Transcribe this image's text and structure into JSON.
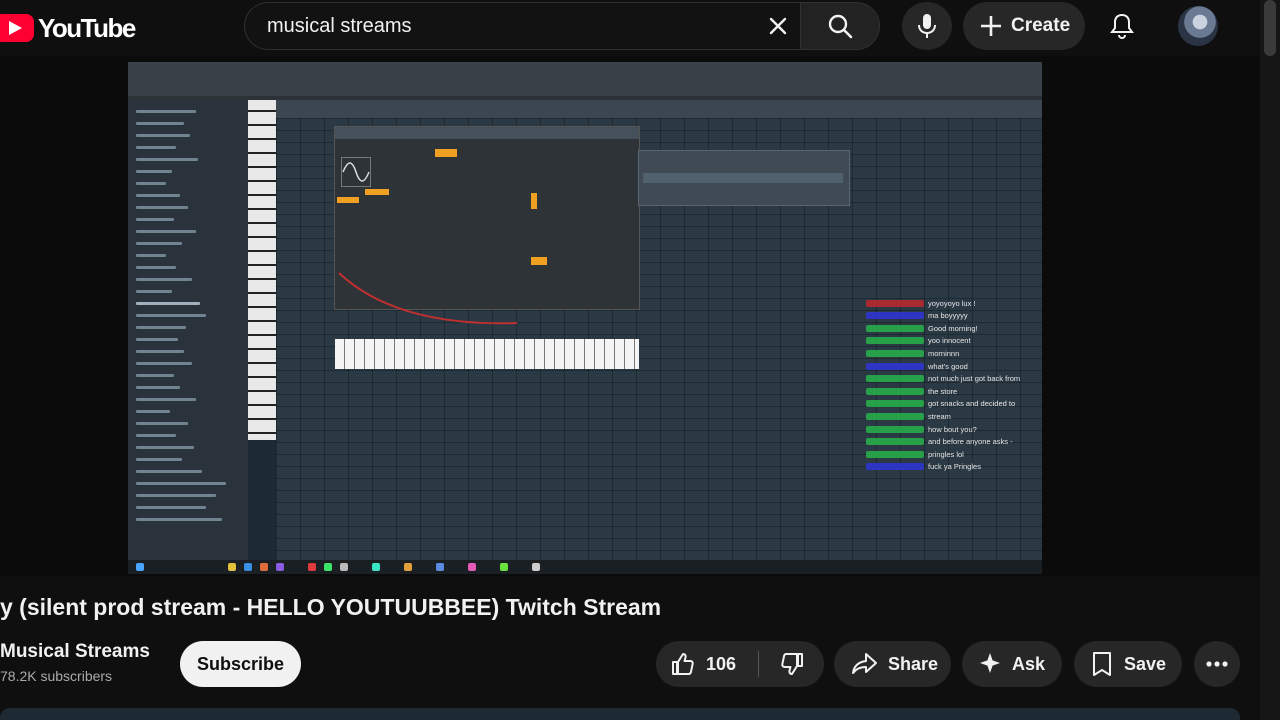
{
  "header": {
    "logo_text": "YouTube",
    "search_value": "musical streams",
    "create_label": "Create"
  },
  "video": {
    "title": "y (silent prod stream - HELLO YOUTUUBBEE) Twitch Stream",
    "chat": [
      {
        "name": "",
        "message": "yoyoyoyo lux !",
        "color": "#c0282d"
      },
      {
        "name": "",
        "message": "ma boyyyyy",
        "color": "#2f35d8"
      },
      {
        "name": "",
        "message": "Good morning!",
        "color": "#27b34a"
      },
      {
        "name": "",
        "message": "yoo innocent",
        "color": "#27b34a"
      },
      {
        "name": "",
        "message": "morninnn",
        "color": "#27b34a"
      },
      {
        "name": "",
        "message": "what's good",
        "color": "#2f35d8"
      },
      {
        "name": "",
        "message": "not much just got back from",
        "color": "#27b34a"
      },
      {
        "name": "",
        "message": "the store",
        "color": "#27b34a"
      },
      {
        "name": "",
        "message": "got snacks and decided to",
        "color": "#27b34a"
      },
      {
        "name": "",
        "message": "stream",
        "color": "#27b34a"
      },
      {
        "name": "",
        "message": "how bout you?",
        "color": "#27b34a"
      },
      {
        "name": "",
        "message": "and before anyone asks -",
        "color": "#27b34a"
      },
      {
        "name": "",
        "message": "pringles lol",
        "color": "#27b34a"
      },
      {
        "name": "",
        "message": "fuck ya Pringles",
        "color": "#2f35d8"
      }
    ]
  },
  "channel": {
    "name": "Musical Streams",
    "subscribers": "78.2K subscribers",
    "subscribe_label": "Subscribe"
  },
  "actions": {
    "likes": "106",
    "share_label": "Share",
    "ask_label": "Ask",
    "save_label": "Save"
  },
  "colors": {
    "accent": "#ff0033",
    "background": "#0f0f0f",
    "button_bg": "#272727"
  }
}
